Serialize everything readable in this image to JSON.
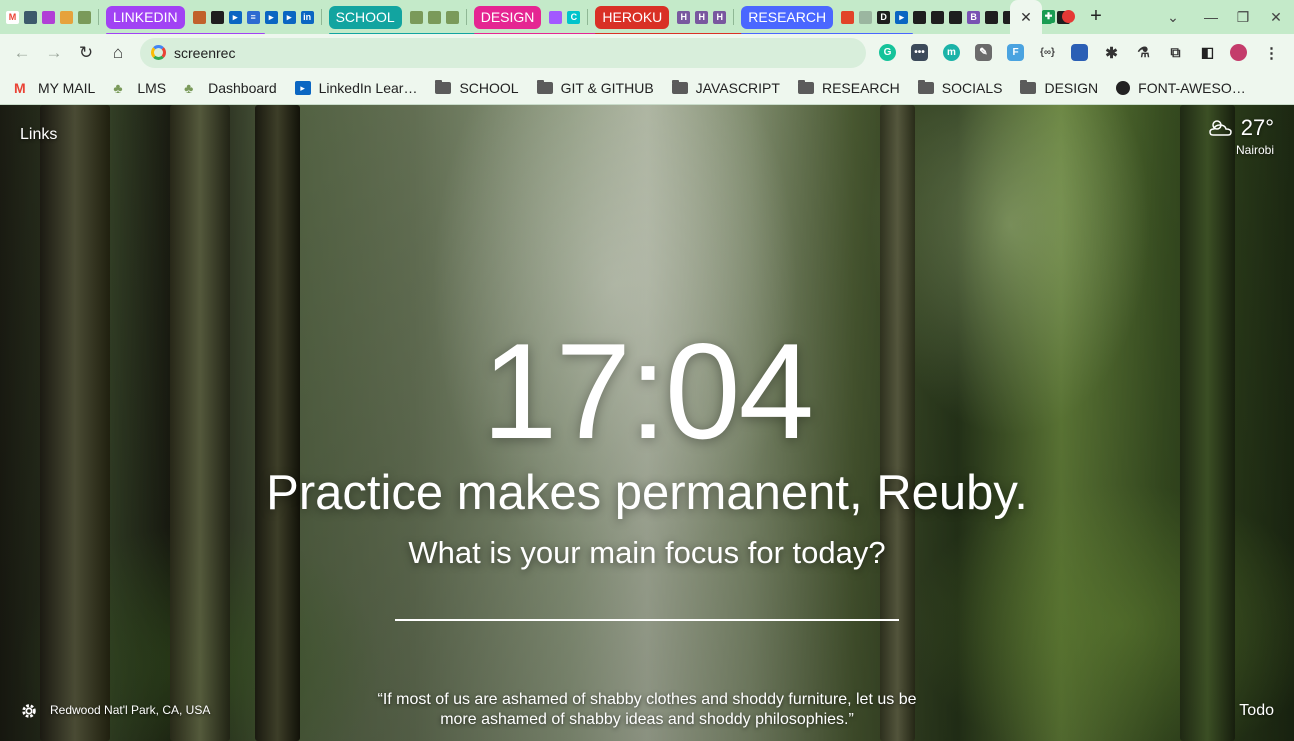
{
  "tabstrip": {
    "groups": [
      {
        "label": "LINKEDIN",
        "color": "#a142f4"
      },
      {
        "label": "SCHOOL",
        "color": "#12a4a0"
      },
      {
        "label": "DESIGN",
        "color": "#e52592"
      },
      {
        "label": "HEROKU",
        "color": "#d93025"
      },
      {
        "label": "RESEARCH",
        "color": "#4a67ff"
      }
    ],
    "active_tab_close": "✕",
    "new_tab": "+"
  },
  "toolbar": {
    "omnibox_value": "screenrec"
  },
  "bookmarks": [
    {
      "label": "MY MAIL",
      "icon": "gmail-icon"
    },
    {
      "label": "LMS",
      "icon": "tree-icon"
    },
    {
      "label": "Dashboard",
      "icon": "tree-icon"
    },
    {
      "label": "LinkedIn Lear…",
      "icon": "linkedin-learning-icon"
    },
    {
      "label": "SCHOOL",
      "icon": "folder-icon"
    },
    {
      "label": "GIT & GITHUB",
      "icon": "folder-icon"
    },
    {
      "label": "JAVASCRIPT",
      "icon": "folder-icon"
    },
    {
      "label": "RESEARCH",
      "icon": "folder-icon"
    },
    {
      "label": "SOCIALS",
      "icon": "folder-icon"
    },
    {
      "label": "DESIGN",
      "icon": "folder-icon"
    },
    {
      "label": "FONT-AWESO…",
      "icon": "github-icon"
    }
  ],
  "momentum": {
    "links": "Links",
    "weather_temp": "27°",
    "weather_city": "Nairobi",
    "clock": "17:04",
    "greeting": "Practice makes permanent, Reuby.",
    "focus_question": "What is your main focus for today?",
    "focus_value": "",
    "photo_location": "Redwood Nat'l Park, CA, USA",
    "quote": "“If most of us are ashamed of shabby clothes and shoddy furniture, let us be more ashamed of shabby ideas and shoddy philosophies.”",
    "todo": "Todo"
  }
}
